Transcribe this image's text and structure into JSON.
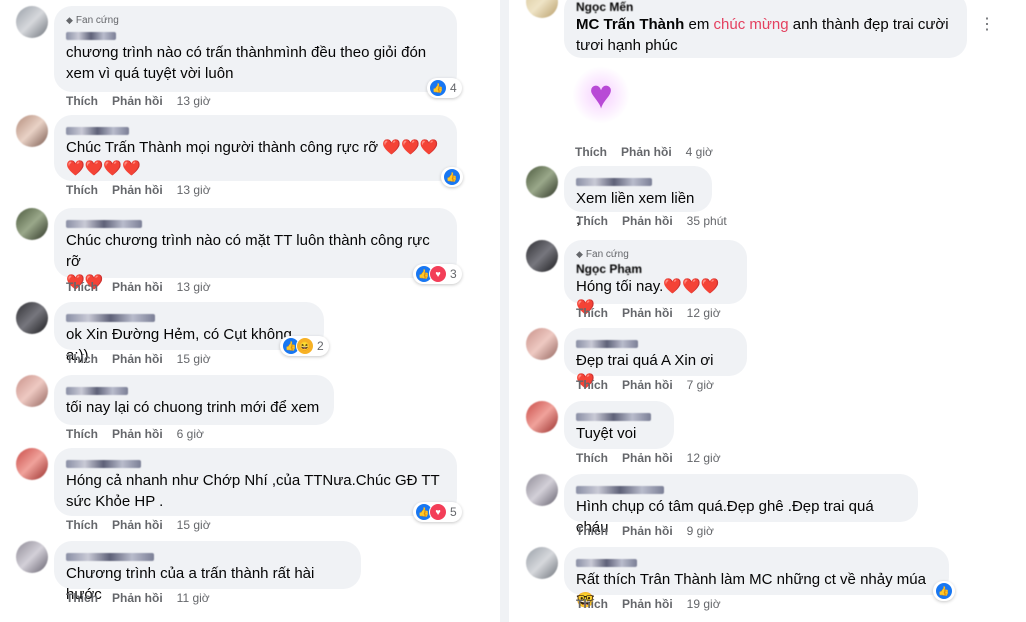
{
  "action_like": "Thích",
  "action_reply": "Phản hồi",
  "fan_badge": "Fan cứng",
  "left": [
    {
      "time": "13 giờ",
      "fan": true,
      "lines": [
        "chương trình nào có trấn thànhmình đều theo giỏi đón",
        "xem vì quá tuyệt vời luôn"
      ],
      "reactions": {
        "types": [
          "like"
        ],
        "count": "4"
      }
    },
    {
      "time": "13 giờ",
      "fan": false,
      "lines": [
        "Chúc Trấn Thành mọi người thành công rực rỡ ❤️❤️❤️",
        "❤️❤️❤️❤️"
      ],
      "reactions": {
        "types": [
          "like"
        ],
        "count": ""
      }
    },
    {
      "time": "13 giờ",
      "fan": false,
      "lines": [
        "Chúc chương trình nào có mặt TT luôn thành công rực rỡ",
        "❤️❤️"
      ],
      "reactions": {
        "types": [
          "like",
          "love"
        ],
        "count": "3"
      }
    },
    {
      "time": "15 giờ",
      "fan": false,
      "lines": [
        "ok Xin Đường Hẻm, có Cụt không a:))"
      ],
      "reactions": {
        "types": [
          "like",
          "haha"
        ],
        "count": "2"
      }
    },
    {
      "time": "6 giờ",
      "fan": false,
      "lines": [
        "tối nay lại có chuong trinh mới để xem"
      ],
      "reactions": null
    },
    {
      "time": "15 giờ",
      "fan": false,
      "lines": [
        "Hóng cả nhanh như Chớp Nhí ,của TTNưa.Chúc GĐ TT",
        "sức Khỏe HP ."
      ],
      "reactions": {
        "types": [
          "like",
          "love"
        ],
        "count": "5"
      }
    },
    {
      "time": "11 giờ",
      "fan": false,
      "lines": [
        "Chương trình của a trấn thành rất hài hước"
      ],
      "reactions": null
    }
  ],
  "right_top": {
    "name": "Ngọc Mến",
    "mention": "MC Trấn Thành",
    "before": " em ",
    "highlight": "chúc mừng",
    "after": " anh thành đẹp trai cười",
    "line2": "tươi hạnh phúc",
    "time": "4 giờ",
    "sticker_icon": "heart-sticker-icon"
  },
  "right": [
    {
      "time": "35 phút",
      "fan": false,
      "name": "",
      "lines": [
        "Xem liền xem liền ;"
      ],
      "reactions": null
    },
    {
      "time": "12 giờ",
      "fan": true,
      "name": "Ngọc Phạm",
      "lines": [
        "Hóng tối nay.❤️❤️❤️❤️"
      ],
      "reactions": null
    },
    {
      "time": "7 giờ",
      "fan": false,
      "name": "",
      "lines": [
        "Đẹp trai quá A Xin ơi ❤️"
      ],
      "reactions": null
    },
    {
      "time": "12 giờ",
      "fan": false,
      "name": "",
      "lines": [
        "Tuyệt voi"
      ],
      "reactions": null
    },
    {
      "time": "9 giờ",
      "fan": false,
      "name": "",
      "lines": [
        "Hình chụp có tâm quá.Đẹp ghê .Đẹp trai quá cháu"
      ],
      "reactions": null
    },
    {
      "time": "19 giờ",
      "fan": false,
      "name": "",
      "lines": [
        "Rất thích Trân Thành làm MC những ct về nhảy múa 🤓"
      ],
      "reactions": {
        "types": [
          "like"
        ],
        "count": ""
      }
    }
  ],
  "colors": {
    "highlight": "#e4405f",
    "bubble": "#f0f2f5",
    "like": "#1877f2",
    "love": "#f33e58"
  }
}
